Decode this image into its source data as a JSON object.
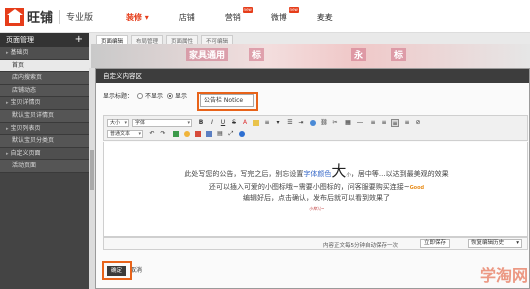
{
  "app": {
    "logo_text": "旺铺",
    "edition": "专业版"
  },
  "topnav": [
    {
      "label": "装修 ▾",
      "active": true,
      "badge": ""
    },
    {
      "label": "店铺",
      "active": false,
      "badge": ""
    },
    {
      "label": "营销",
      "active": false,
      "badge": "new"
    },
    {
      "label": "微博",
      "active": false,
      "badge": "new"
    },
    {
      "label": "麦麦",
      "active": false,
      "badge": ""
    }
  ],
  "sidebar": {
    "title": "页面管理",
    "add": "+",
    "items": [
      {
        "label": "基础页",
        "type": "group"
      },
      {
        "label": "首页",
        "type": "sub",
        "active": true
      },
      {
        "label": "店内搜索页",
        "type": "sub"
      },
      {
        "label": "店铺动态",
        "type": "sub"
      },
      {
        "label": "宝贝详情页",
        "type": "group"
      },
      {
        "label": "默认宝贝详情页",
        "type": "sub"
      },
      {
        "label": "宝贝列表页",
        "type": "group"
      },
      {
        "label": "默认宝贝分类页",
        "type": "sub"
      },
      {
        "label": "自定义页面",
        "type": "group"
      },
      {
        "label": "活动页面",
        "type": "sub"
      }
    ]
  },
  "subtabs": [
    "页面编辑",
    "布局管理",
    "页面属性",
    "不可编辑"
  ],
  "banner": {
    "texts": [
      "家具通用",
      "标",
      "永",
      "标"
    ]
  },
  "dialog": {
    "title": "自定义内容区",
    "show_title_label": "显示标题：",
    "radio_hide": "不显示",
    "radio_show": "显示",
    "title_value": "公告栏 Notice",
    "toolbar": {
      "size_select": "大小",
      "font_select": "字体",
      "format_select": "普通文本"
    },
    "content": {
      "line1_a": "此处写您的公告，写完之后，别忘设置",
      "line1_blue": "字体颜色",
      "line1_big": "大",
      "line1_small": "小",
      "line1_b": "，居中等...以达到最美观的效果",
      "line2": "还可以插入可爱的小图标哦~需要小图标的，问客服要购买连接~",
      "good": "Good",
      "line3": "编辑好后，点击确认，发布后就可以看到效果了",
      "scribble": "小样儿~"
    },
    "status_msg": "内容正文每5分钟自动保存一次",
    "save_button": "立即保存",
    "history": "恢复编辑历史",
    "ok_button": "确定",
    "cancel_button": "取消"
  },
  "watermark": "学淘网",
  "colors": {
    "accent": "#e63d1a",
    "highlight": "#e8631a",
    "sidebar_bg": "#444444",
    "link_blue": "#3a6bc9"
  }
}
